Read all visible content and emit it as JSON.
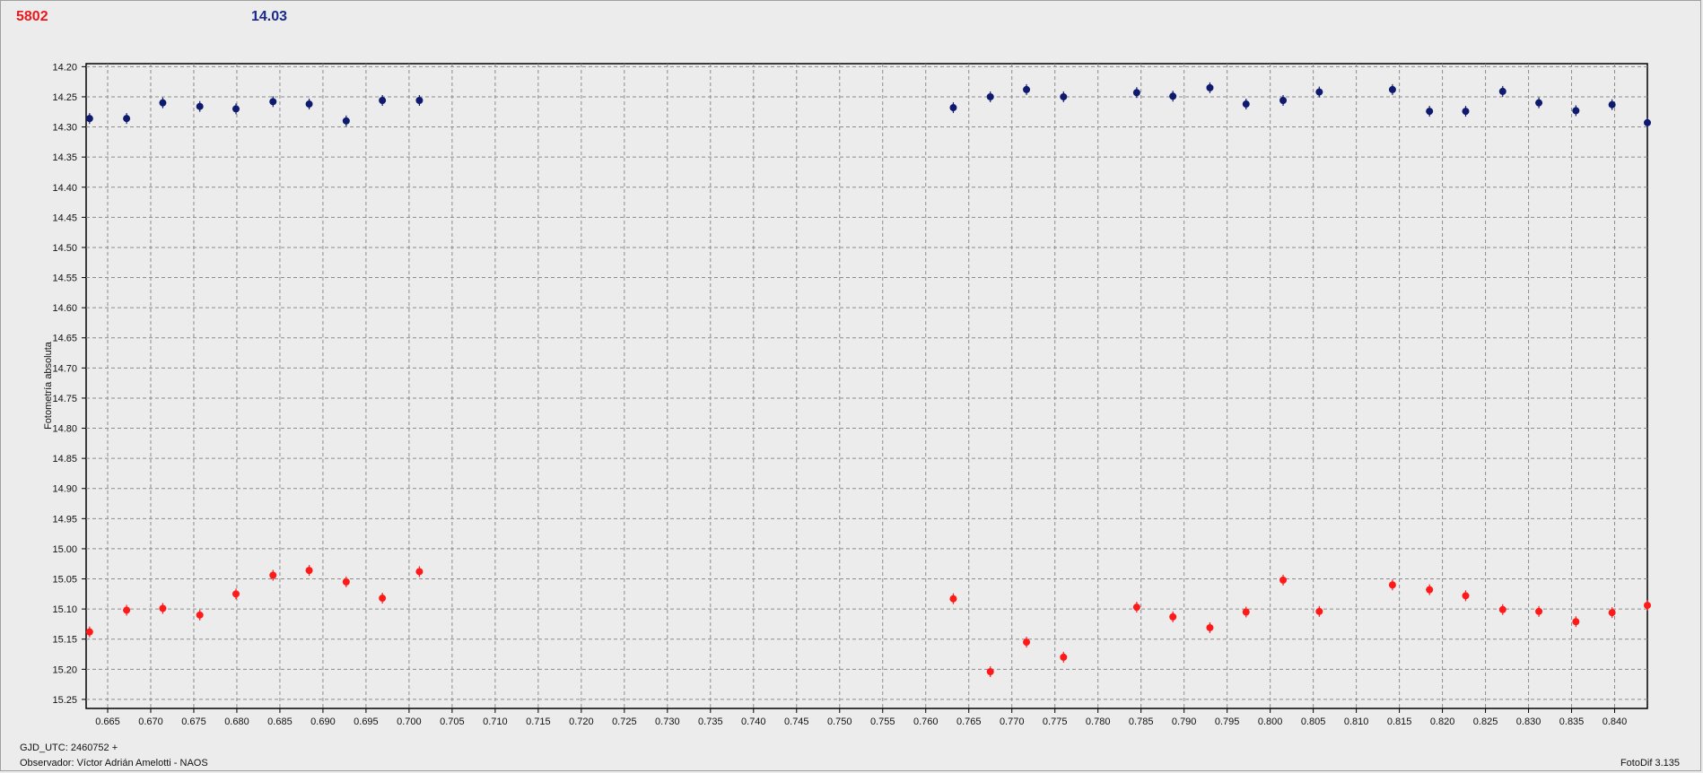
{
  "header": {
    "left_value": "5802",
    "right_value": "14.03"
  },
  "footer": {
    "date_label": "GJD_UTC: 2460752 +",
    "observer": "Observador: Víctor Adrián Amelotti - NAOS",
    "software": "FotoDif 3.135"
  },
  "colors": {
    "series_red": "#ff1a1a",
    "series_blue": "#0d1a6e",
    "grid": "#8c8c8c",
    "plot_bg": "#ececec"
  },
  "chart_data": {
    "type": "scatter",
    "title": "",
    "xlabel": "",
    "ylabel": "Fotometría absoluta",
    "xlim": [
      0.6625,
      0.8438
    ],
    "ylim": [
      15.265,
      14.195
    ],
    "y_inverted": true,
    "grid": true,
    "x_ticks": [
      0.665,
      0.67,
      0.675,
      0.68,
      0.685,
      0.69,
      0.695,
      0.7,
      0.705,
      0.71,
      0.715,
      0.72,
      0.725,
      0.73,
      0.735,
      0.74,
      0.745,
      0.75,
      0.755,
      0.76,
      0.765,
      0.77,
      0.775,
      0.78,
      0.785,
      0.79,
      0.795,
      0.8,
      0.805,
      0.81,
      0.815,
      0.82,
      0.825,
      0.83,
      0.835,
      0.84
    ],
    "x_tick_labels": [
      "0.665",
      "0.670",
      "0.675",
      "0.680",
      "0.685",
      "0.690",
      "0.695",
      "0.700",
      "0.705",
      "0.710",
      "0.715",
      "0.720",
      "0.725",
      "0.730",
      "0.735",
      "0.740",
      "0.745",
      "0.750",
      "0.755",
      "0.760",
      "0.765",
      "0.770",
      "0.775",
      "0.780",
      "0.785",
      "0.790",
      "0.795",
      "0.800",
      "0.805",
      "0.810",
      "0.815",
      "0.820",
      "0.825",
      "0.830",
      "0.835",
      "0.840"
    ],
    "y_ticks": [
      14.2,
      14.25,
      14.3,
      14.35,
      14.4,
      14.45,
      14.5,
      14.55,
      14.6,
      14.65,
      14.7,
      14.75,
      14.8,
      14.85,
      14.9,
      14.95,
      15.0,
      15.05,
      15.1,
      15.15,
      15.2,
      15.25
    ],
    "y_tick_labels": [
      "14.20",
      "14.25",
      "14.30",
      "14.35",
      "14.40",
      "14.45",
      "14.50",
      "14.55",
      "14.60",
      "14.65",
      "14.70",
      "14.75",
      "14.80",
      "14.85",
      "14.90",
      "14.95",
      "15.00",
      "15.05",
      "15.10",
      "15.15",
      "15.20",
      "15.25"
    ],
    "series": [
      {
        "color": "#0d1a6e",
        "x": [
          0.6629,
          0.6672,
          0.6714,
          0.6757,
          0.6799,
          0.6842,
          0.6884,
          0.6927,
          0.6969,
          0.7012,
          0.7632,
          0.7675,
          0.7717,
          0.776,
          0.7845,
          0.7887,
          0.793,
          0.7972,
          0.8015,
          0.8057,
          0.8142,
          0.8185,
          0.8227,
          0.827,
          0.8312,
          0.8355,
          0.8397,
          0.8438
        ],
        "y": [
          14.286,
          14.286,
          14.26,
          14.266,
          14.27,
          14.258,
          14.262,
          14.29,
          14.256,
          14.256,
          14.268,
          14.25,
          14.238,
          14.25,
          14.243,
          14.249,
          14.235,
          14.262,
          14.256,
          14.242,
          14.238,
          14.274,
          14.274,
          14.241,
          14.26,
          14.273,
          14.263,
          14.293
        ]
      },
      {
        "color": "#ff1a1a",
        "x": [
          0.6629,
          0.6672,
          0.6714,
          0.6757,
          0.6799,
          0.6842,
          0.6884,
          0.6927,
          0.6969,
          0.7012,
          0.7632,
          0.7675,
          0.7717,
          0.776,
          0.7845,
          0.7887,
          0.793,
          0.7972,
          0.8015,
          0.8057,
          0.8142,
          0.8185,
          0.8227,
          0.827,
          0.8312,
          0.8355,
          0.8397,
          0.8438
        ],
        "y": [
          15.138,
          15.102,
          15.099,
          15.11,
          15.075,
          15.044,
          15.036,
          15.055,
          15.082,
          15.038,
          15.083,
          15.204,
          15.155,
          15.18,
          15.097,
          15.113,
          15.131,
          15.105,
          15.052,
          15.104,
          15.06,
          15.068,
          15.078,
          15.101,
          15.104,
          15.121,
          15.106,
          15.094
        ]
      }
    ]
  }
}
